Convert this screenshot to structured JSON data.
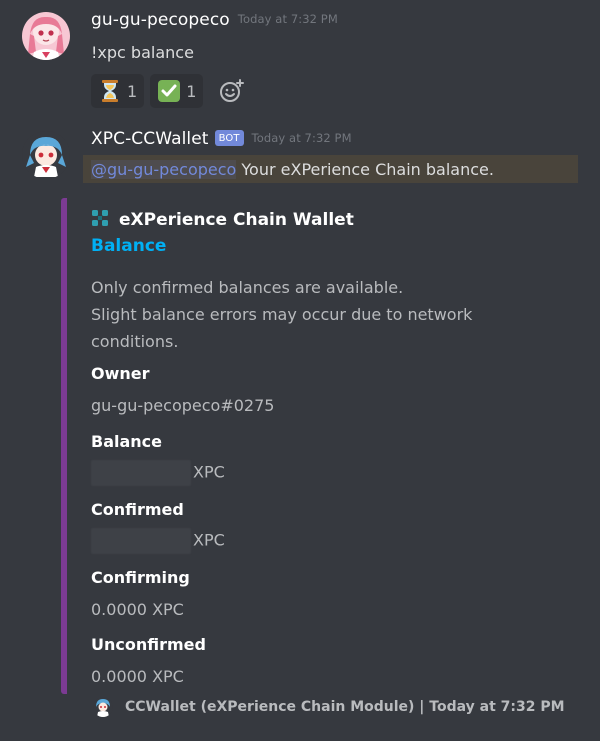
{
  "messages": [
    {
      "author": "gu-gu-pecopeco",
      "timestamp": "Today at 7:32 PM",
      "content": "!xpc balance",
      "reactions": [
        {
          "emoji": "hourglass-icon",
          "count": "1"
        },
        {
          "emoji": "check-mark-icon",
          "count": "1"
        }
      ]
    },
    {
      "author": "XPC-CCWallet",
      "bot_tag": "BOT",
      "timestamp": "Today at 7:32 PM",
      "mention": "@gu-gu-pecopeco",
      "content": " Your eXPerience Chain balance."
    }
  ],
  "embed": {
    "author": "eXPerience Chain Wallet",
    "title": "Balance",
    "description_line1": "Only confirmed balances are available.",
    "description_line2": "Slight balance errors may occur due to network conditions.",
    "fields": [
      {
        "name": "Owner",
        "value": "gu-gu-pecopeco#0275"
      },
      {
        "name": "Balance",
        "value": "XPC"
      },
      {
        "name": "Confirmed",
        "value": "XPC"
      },
      {
        "name": "Confirming",
        "value": "0.0000 XPC"
      },
      {
        "name": "Unconfirmed",
        "value": "0.0000 XPC"
      }
    ],
    "footer": "CCWallet (eXPerience Chain Module) | Today at 7:32 PM",
    "accent_color": "#7c3b93",
    "title_color": "#00b0f4"
  },
  "colors": {
    "background": "#36393f",
    "mention": "#7289da",
    "bot_tag": "#7289da"
  }
}
